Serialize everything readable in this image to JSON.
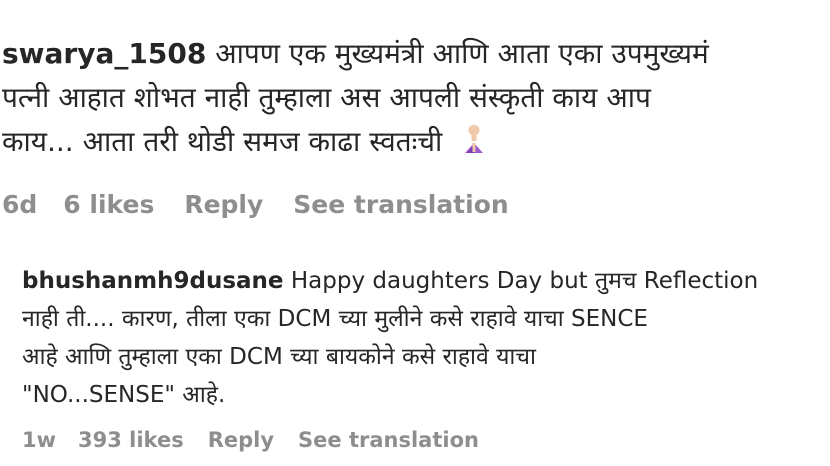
{
  "comments": [
    {
      "username": "swarya_1508",
      "lines": [
        "आपण एक मुख्यमंत्री आणि आता एका उपमुख्यमं",
        "पत्नी आहात शोभत नाही तुम्हाला अस आपली संस्कृती काय आप",
        "काय... आता तरी थोडी समज काढा स्वतःची"
      ],
      "emoji": "person-bowing-icon",
      "age": "6d",
      "likes": "6 likes",
      "reply_label": "Reply",
      "translate_label": "See translation"
    },
    {
      "username": "bhushanmh9dusane",
      "lines": [
        "Happy daughters Day but तुमच Reflection",
        "नाही ती.... कारण, तीला एका DCM च्या मुलीने कसे राहावे याचा SENCE",
        "आहे आणि तुम्हाला एका DCM च्या बायकोने कसे राहावे याचा",
        "\"NO...SENSE\" आहे."
      ],
      "age": "1w",
      "likes": "393 likes",
      "reply_label": "Reply",
      "translate_label": "See translation"
    }
  ],
  "colors": {
    "text": "#262626",
    "meta": "#8e8e8e",
    "background": "#ffffff"
  }
}
